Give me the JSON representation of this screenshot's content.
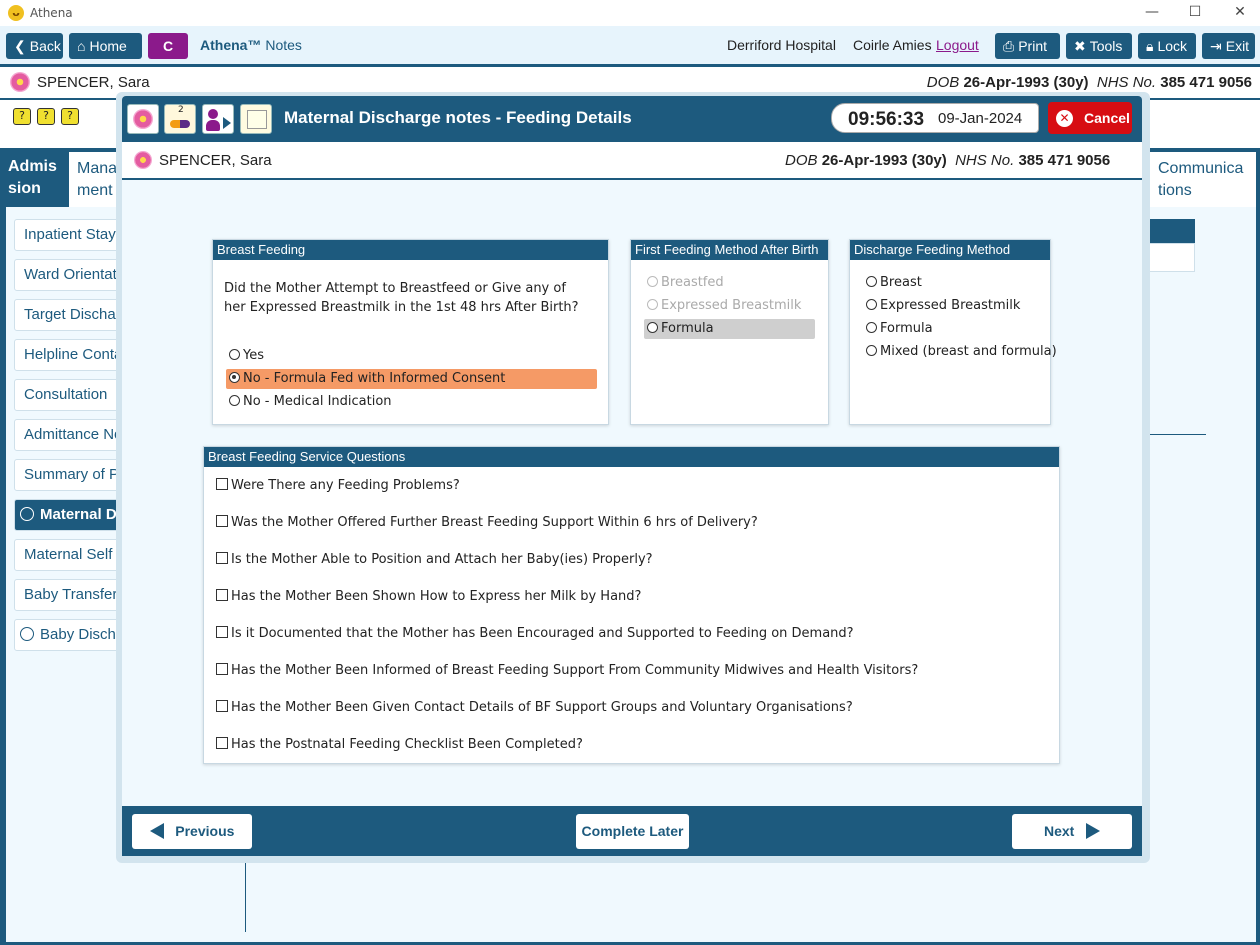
{
  "window": {
    "title": "Athena",
    "minimize": "—",
    "maximize": "☐",
    "close": "✕"
  },
  "toolbar": {
    "back": "Back",
    "home": "Home",
    "c_button": "C",
    "app_name": "Athena™",
    "app_section": "Notes",
    "hospital": "Derriford Hospital",
    "user": "Coirle Amies",
    "logout": "Logout",
    "print": "Print",
    "tools": "Tools",
    "lock": "Lock",
    "exit": "Exit"
  },
  "patient": {
    "name": "SPENCER, Sara",
    "dob_label": "DOB",
    "dob": "26-Apr-1993 (30y)",
    "nhs_label": "NHS No.",
    "nhs": "385 471 9056"
  },
  "background": {
    "tabs": [
      {
        "label": "Admis\nsion"
      },
      {
        "label": "Mana\nment"
      },
      {
        "label": "Communica\ntions"
      }
    ],
    "sidebar": [
      {
        "label": "Inpatient Stay"
      },
      {
        "label": "Ward Orientation"
      },
      {
        "label": "Target Discharge"
      },
      {
        "label": "Helpline Contact"
      },
      {
        "label": "Consultation"
      },
      {
        "label": "Admittance Notes"
      },
      {
        "label": "Summary of P"
      },
      {
        "label": "Maternal Discharge"
      },
      {
        "label": "Maternal Self"
      },
      {
        "label": "Baby Transfer"
      },
      {
        "label": "Baby Discharge"
      }
    ]
  },
  "modal": {
    "title": "Maternal Discharge notes - Feeding Details",
    "icon_badge": "2",
    "time": "09:56:33",
    "date": "09-Jan-2024",
    "cancel": "Cancel",
    "breast_feeding": {
      "header": "Breast Feeding",
      "question": "Did the Mother Attempt to Breastfeed or Give any of her Expressed Breastmilk in the 1st 48 hrs After Birth?",
      "options": [
        {
          "label": "Yes",
          "selected": false
        },
        {
          "label": "No - Formula Fed with Informed Consent",
          "selected": true
        },
        {
          "label": "No - Medical Indication",
          "selected": false
        }
      ],
      "highlight_color": "#f59a66"
    },
    "first_feeding": {
      "header": "First Feeding Method After Birth",
      "options": [
        {
          "label": "Breastfed",
          "disabled": true
        },
        {
          "label": "Expressed Breastmilk",
          "disabled": true
        },
        {
          "label": "Formula",
          "disabled": false
        }
      ]
    },
    "discharge_feeding": {
      "header": "Discharge Feeding Method",
      "options": [
        {
          "label": "Breast"
        },
        {
          "label": "Expressed Breastmilk"
        },
        {
          "label": "Formula"
        },
        {
          "label": "Mixed (breast and formula)"
        }
      ]
    },
    "service_questions": {
      "header": "Breast Feeding Service Questions",
      "items": [
        {
          "label": "Were There any Feeding Problems?"
        },
        {
          "label": "Was the Mother Offered Further Breast Feeding Support Within 6 hrs of Delivery?"
        },
        {
          "label": "Is the Mother Able to Position and Attach her Baby(ies) Properly?"
        },
        {
          "label": "Has the Mother Been Shown How to Express her Milk by Hand?"
        },
        {
          "label": "Is it Documented that the Mother has Been Encouraged and Supported to Feeding on Demand?"
        },
        {
          "label": "Has the Mother Been Informed of Breast Feeding Support From Community Midwives and Health Visitors?"
        },
        {
          "label": "Has the Mother Been Given Contact Details of BF Support Groups and Voluntary Organisations?"
        },
        {
          "label": "Has the Postnatal Feeding Checklist Been Completed?"
        }
      ]
    },
    "footer": {
      "previous": "Previous",
      "complete_later": "Complete Later",
      "next": "Next"
    }
  },
  "colors": {
    "primary": "#1d5a7e",
    "cancel": "#d70d12",
    "c_button": "#8b1a8b",
    "light_bg": "#f0f9fe"
  }
}
